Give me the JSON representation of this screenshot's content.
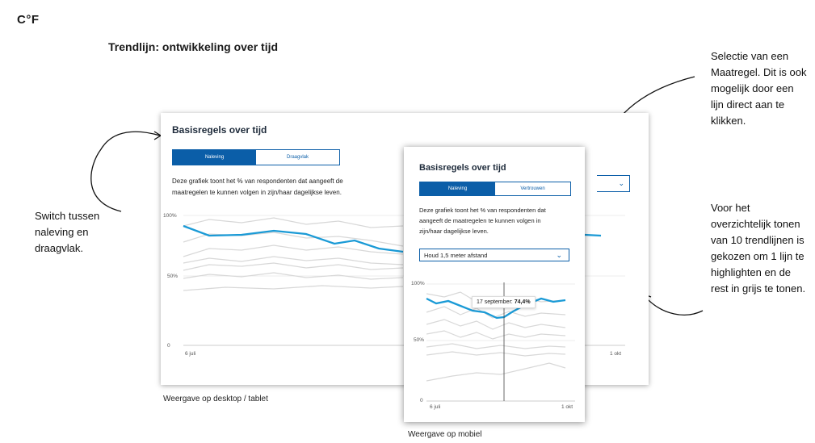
{
  "logo": "C°F",
  "page_title": "Trendlijn: ontwikkeling over tijd",
  "notes": {
    "switch": [
      "Switch tussen",
      "naleving en",
      "draagvlak."
    ],
    "select": [
      "Selectie van een",
      "Maatregel. Dit is ook",
      "mogelijk door een",
      "lijn direct aan te",
      "klikken."
    ],
    "trend": [
      "Voor het",
      "overzichtelijk tonen",
      "van 10 trendlijnen is",
      "gekozen om 1 lijn te",
      "highlighten en de",
      "rest in grijs te tonen."
    ]
  },
  "captions": {
    "desktop": "Weergave op desktop / tablet",
    "mobile": "Weergave op mobiel"
  },
  "desktop": {
    "title": "Basisregels over tijd",
    "tab_active": "Naleving",
    "tab_inactive": "Draagvlak",
    "description_line1": "Deze grafiek toont het % van respondenten dat aangeeft de",
    "description_line2": "maatregelen te kunnen volgen in zijn/haar dagelijkse leven.",
    "y_labels": [
      "100%",
      "50%",
      "0"
    ],
    "x_start": "6 juli",
    "x_end": "1 okt"
  },
  "mobile": {
    "title": "Basisregels over tijd",
    "tab_active": "Naleving",
    "tab_inactive": "Vertrouwen",
    "description_line1": "Deze grafiek toont het % van respondenten dat",
    "description_line2": "aangeeft de maatregelen te kunnen volgen in",
    "description_line3": "zijn/haar dagelijkse leven.",
    "select_value": "Houd 1,5 meter afstand",
    "y_labels": [
      "100%",
      "50%",
      "0"
    ],
    "x_start": "6 juli",
    "x_end": "1 okt",
    "tooltip_date": "17 september:",
    "tooltip_value": "74,4%"
  },
  "colors": {
    "highlight": "#1a9ad6",
    "grey": "#d8d8d8",
    "accent": "#0b5ea8"
  },
  "icons": [
    "chevron-down-icon",
    "arrow-curve-icon"
  ]
}
